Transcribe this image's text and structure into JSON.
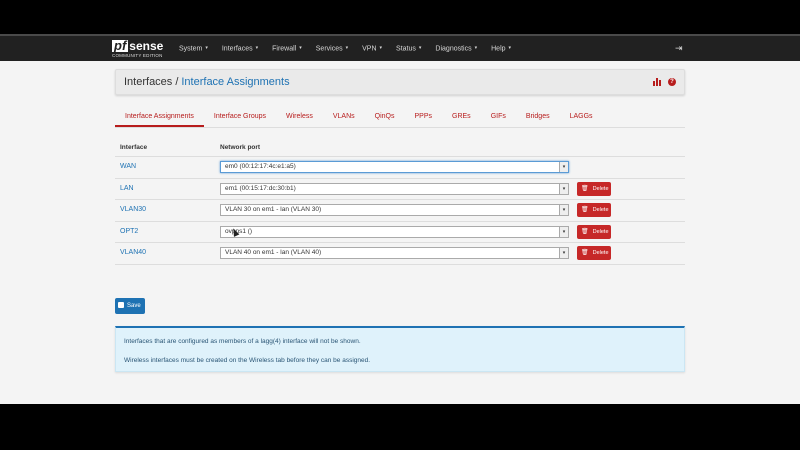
{
  "brand": {
    "logo_pf": "pf",
    "logo_sense": "sense",
    "edition": "COMMUNITY EDITION"
  },
  "nav": {
    "items": [
      "System",
      "Interfaces",
      "Firewall",
      "Services",
      "VPN",
      "Status",
      "Diagnostics",
      "Help"
    ],
    "caret": "▾",
    "logout_icon": "sign-out-icon"
  },
  "breadcrumb": {
    "parent": "Interfaces",
    "separator": "/",
    "current": "Interface Assignments"
  },
  "tabs": [
    {
      "label": "Interface Assignments",
      "active": true
    },
    {
      "label": "Interface Groups"
    },
    {
      "label": "Wireless"
    },
    {
      "label": "VLANs"
    },
    {
      "label": "QinQs"
    },
    {
      "label": "PPPs"
    },
    {
      "label": "GREs"
    },
    {
      "label": "GIFs"
    },
    {
      "label": "Bridges"
    },
    {
      "label": "LAGGs"
    }
  ],
  "table": {
    "headers": {
      "interface": "Interface",
      "network_port": "Network port"
    },
    "rows": [
      {
        "interface": "WAN",
        "port": "em0 (00:12:17:4c:e1:a5)",
        "deletable": false
      },
      {
        "interface": "LAN",
        "port": "em1 (00:15:17:dc:30:b1)",
        "deletable": true
      },
      {
        "interface": "VLAN30",
        "port": "VLAN 30 on em1 - lan (VLAN 30)",
        "deletable": true
      },
      {
        "interface": "OPT2",
        "port": "ovpns1 ()",
        "deletable": true
      },
      {
        "interface": "VLAN40",
        "port": "VLAN 40 on em1 - lan (VLAN 40)",
        "deletable": true
      }
    ],
    "delete_label": "Delete"
  },
  "save_label": "Save",
  "info": {
    "line1": "Interfaces that are configured as members of a lagg(4) interface will not be shown.",
    "line2": "Wireless interfaces must be created on the Wireless tab before they can be assigned."
  },
  "colors": {
    "navbar": "#212121",
    "accent_red": "#b71c1c",
    "link_blue": "#1e72b3",
    "info_bg": "#dff2fb"
  }
}
